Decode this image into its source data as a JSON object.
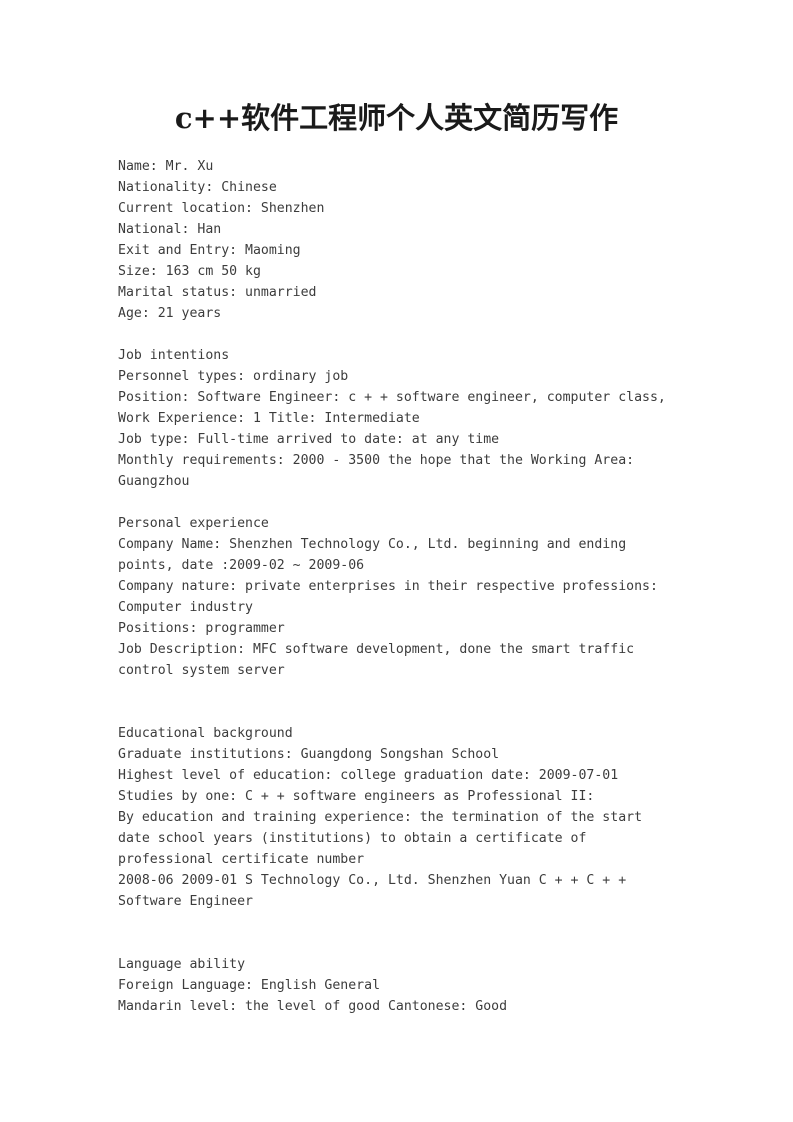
{
  "document": {
    "title": "c++软件工程师个人英文简历写作",
    "background_color": "#ffffff",
    "text_color": "#3c3c3c",
    "title_color": "#1a1a1a"
  },
  "personal_info": {
    "lines": [
      "Name: Mr. Xu",
      "Nationality: Chinese",
      "Current location: Shenzhen",
      "National: Han",
      "Exit and Entry: Maoming",
      "Size: 163 cm 50 kg",
      "Marital status: unmarried",
      "Age: 21 years"
    ]
  },
  "job_intentions": {
    "heading": "Job intentions",
    "lines": [
      "Personnel types: ordinary job",
      "Position: Software Engineer: c + + software engineer, computer class,",
      "Work Experience: 1 Title: Intermediate",
      "Job type: Full-time arrived to date: at any time",
      "Monthly requirements: 2000 - 3500 the hope that the Working Area: Guangzhou"
    ]
  },
  "personal_experience": {
    "heading": "Personal experience",
    "lines": [
      "Company Name: Shenzhen Technology Co., Ltd. beginning and ending points, date :2009-02 ~ 2009-06",
      "Company nature: private enterprises in their respective professions: Computer industry",
      "Positions: programmer",
      "Job Description: MFC software development, done the smart traffic control system server"
    ]
  },
  "educational_background": {
    "heading": "Educational background",
    "lines": [
      "Graduate institutions: Guangdong Songshan School",
      "Highest level of education: college graduation date: 2009-07-01",
      "Studies by one: C + + software engineers as Professional II:",
      "By education and training experience: the termination of the start date school years (institutions) to obtain a certificate of professional certificate number",
      "2008-06 2009-01 S Technology Co., Ltd. Shenzhen Yuan C + + C + + Software Engineer"
    ]
  },
  "language_ability": {
    "heading": "Language ability",
    "lines": [
      "Foreign Language: English General",
      "Mandarin level: the level of good Cantonese: Good"
    ]
  }
}
